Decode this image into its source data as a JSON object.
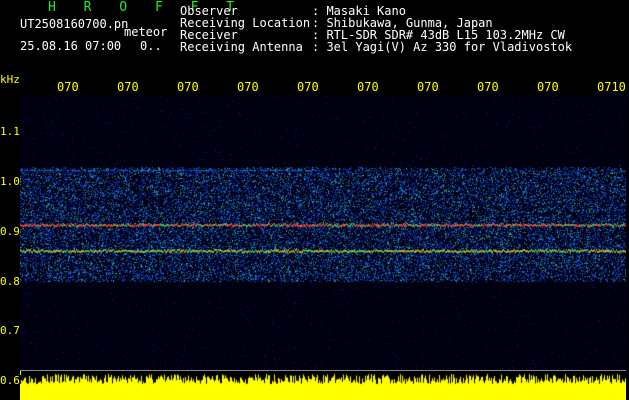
{
  "header": {
    "title": "H R O F F T",
    "filename": "UT2508160700.pn",
    "meteor_label": "meteor",
    "datetime": "25.08.16 07:00",
    "zero": "0..",
    "fields": [
      {
        "label": "Observer",
        "value": ": Masaki Kano"
      },
      {
        "label": "Receiving Location",
        "value": ": Shibukawa, Gunma, Japan"
      },
      {
        "label": "Receiver",
        "value": ": RTL-SDR SDR# 43dB L15 103.2MHz CW"
      },
      {
        "label": "Receiving Antenna",
        "value": ": 3el Yagi(V) Az 330 for Vladivostok"
      }
    ]
  },
  "axes": {
    "y_unit": "kHz",
    "y_ticks": [
      "1.1",
      "1.0",
      "0.9",
      "0.8",
      "0.7",
      "0.6"
    ],
    "x_ticks": [
      "070",
      "070",
      "070",
      "070",
      "070",
      "070",
      "070",
      "070",
      "070",
      "0710"
    ]
  },
  "colors": {
    "background": "#000000",
    "axis": "#ffff00",
    "title": "#22ee22",
    "text": "#ffffff"
  },
  "chart_data": {
    "type": "heatmap",
    "title": "H R O F F T",
    "ylabel": "kHz",
    "ylim": [
      0.6,
      1.13
    ],
    "carrier_lines_khz": [
      0.88,
      0.83
    ],
    "noise_band_khz": [
      0.77,
      0.99
    ]
  }
}
